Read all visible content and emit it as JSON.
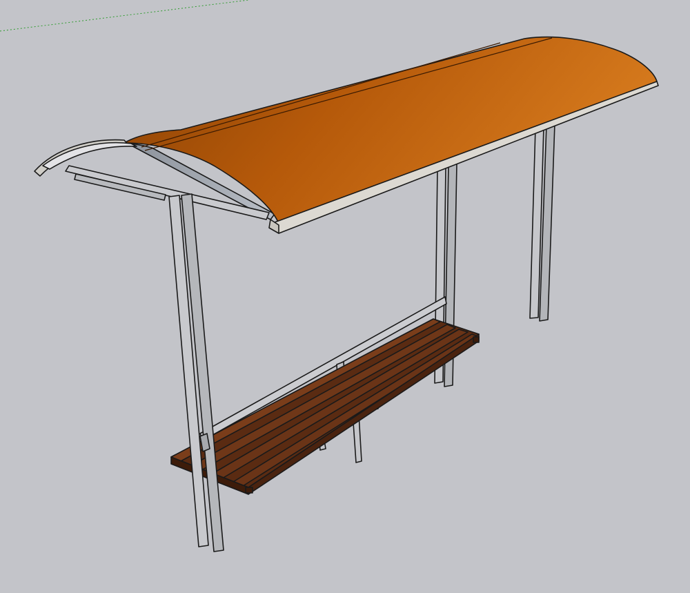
{
  "viewport": {
    "background": "#c3c4c9",
    "scene": "bus-shelter-model"
  },
  "colors": {
    "roof_top": "#c8650a",
    "roof_dark": "#9a4a04",
    "roof_edge": "#d9d6d0",
    "roof_underside": "#8e949e",
    "steel": "#c8c9cd",
    "steel_shade": "#a9abb0",
    "wood": "#6a3417",
    "wood_dark": "#4a230f",
    "axis_green": "#2e9b2e"
  },
  "icons": {
    "axis_line": "green-axis-line"
  }
}
